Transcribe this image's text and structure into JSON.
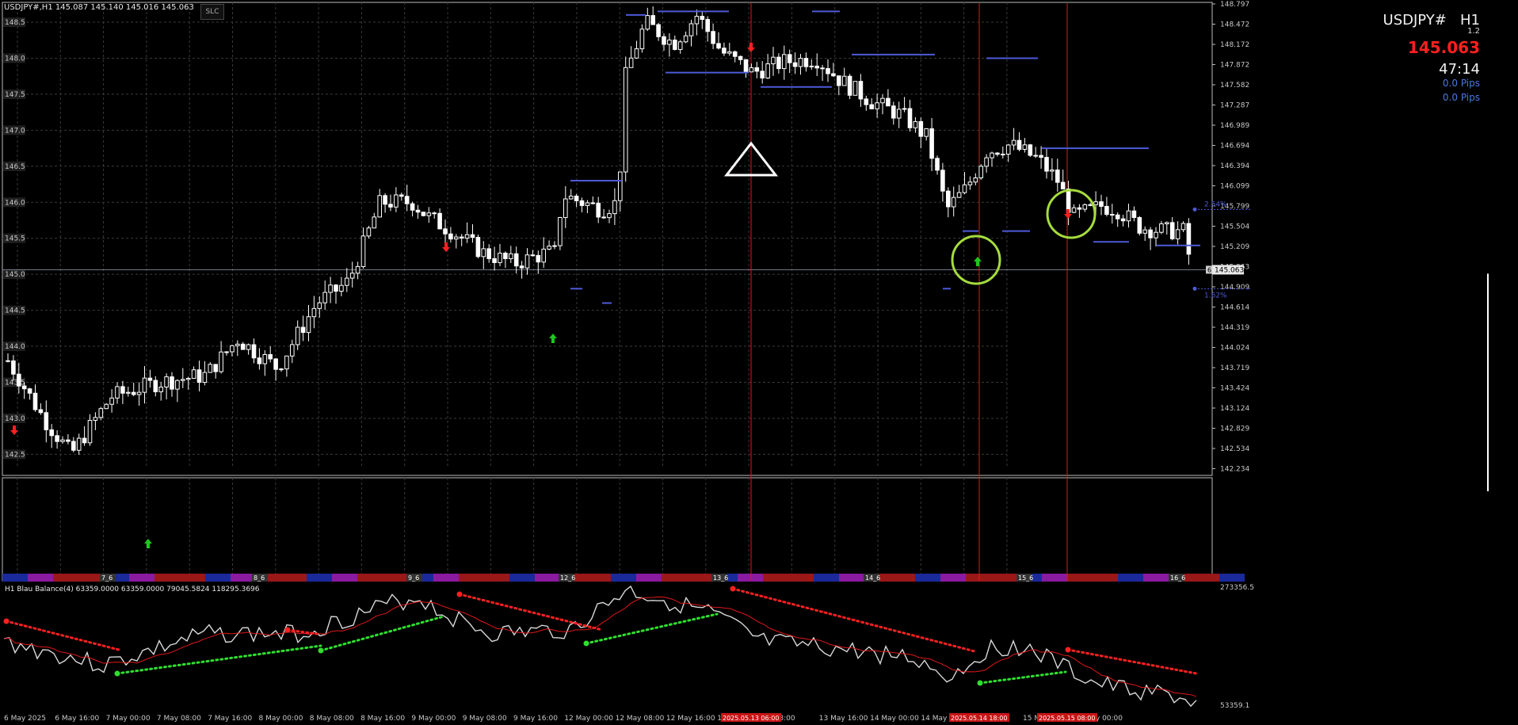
{
  "header": {
    "symbol_line": "USDJPY#,H1  145.087 145.140 145.016 145.063",
    "slc_button": "SLC",
    "indicator_line": "H1 Blau Balance(4) 63359.0000 63359.0000 79045.5824 118295.3696"
  },
  "info_panel": {
    "symbol": "USDJPY#",
    "timeframe": "H1",
    "spread": "1.2",
    "bid": "145.063",
    "countdown": "47:14",
    "pips_line_1": "0.0 Pips",
    "pips_line_2": "0.0 Pips",
    "bid_color": "#ff2020",
    "pips_color": "#4a78e0"
  },
  "price_axis": {
    "right_labels": [
      "148.797",
      "148.472",
      "148.172",
      "147.872",
      "147.582",
      "147.287",
      "146.989",
      "146.694",
      "146.394",
      "146.099",
      "145.799",
      "145.504",
      "145.209",
      "145.063",
      "144.909",
      "144.614",
      "144.319",
      "144.024",
      "143.719",
      "143.424",
      "143.124",
      "142.829",
      "142.534",
      "142.234"
    ],
    "left_labels": [
      "148.5",
      "148.0",
      "147.5",
      "147.0",
      "146.5",
      "146.0",
      "145.5",
      "145.0",
      "144.5",
      "144.0",
      "143.5",
      "143.0",
      "142.5"
    ],
    "current_price_tag": "145.063",
    "indicator_top": "273356.5",
    "indicator_bottom": "53359.1"
  },
  "time_axis": {
    "labels": [
      "6 May 2025",
      "6 May 16:00",
      "7 May 00:00",
      "7 May 08:00",
      "7 May 16:00",
      "8 May 00:00",
      "8 May 08:00",
      "8 May 16:00",
      "9 May 00:00",
      "9 May 08:00",
      "9 May 16:00",
      "12 May 00:00",
      "12 May 08:00",
      "12 May 16:00",
      "13",
      "y 08:00",
      "13 May 16:00",
      "14 May 00:00",
      "14 May 0",
      "15 Ma",
      "15 May 16:00",
      "16 May 00:00"
    ],
    "vline_tags": [
      "2025.05.13 06:00",
      "2025.05.14 18:00",
      "2025.05.15 08:00"
    ]
  },
  "session_bar": {
    "day_labels": [
      "7_6",
      "8_6",
      "9_6",
      "12_6",
      "13_6",
      "14_6",
      "15_6",
      "16_6"
    ]
  },
  "annotations": {
    "pct_upper": "2.54%",
    "pct_lower": "1.62%",
    "right_badge": "6"
  },
  "colors": {
    "background": "#000000",
    "grid": "#3a3a3a",
    "candle": "#ffffff",
    "level_line": "#4e5ad8",
    "vline": "#e01818",
    "circle": "#a6dc3c",
    "arrow_up": "#1ec81e",
    "arrow_down": "#ff2020",
    "balance_line": "#d8d8d8",
    "balance_avg": "#e01818",
    "dots_red": "#ff2020",
    "dots_green": "#2ee02e"
  },
  "icons": {
    "up_arrow": "up-arrow-icon",
    "down_arrow": "down-arrow-icon",
    "triangle": "triangle-outline-icon",
    "circle": "circle-outline-icon"
  }
}
